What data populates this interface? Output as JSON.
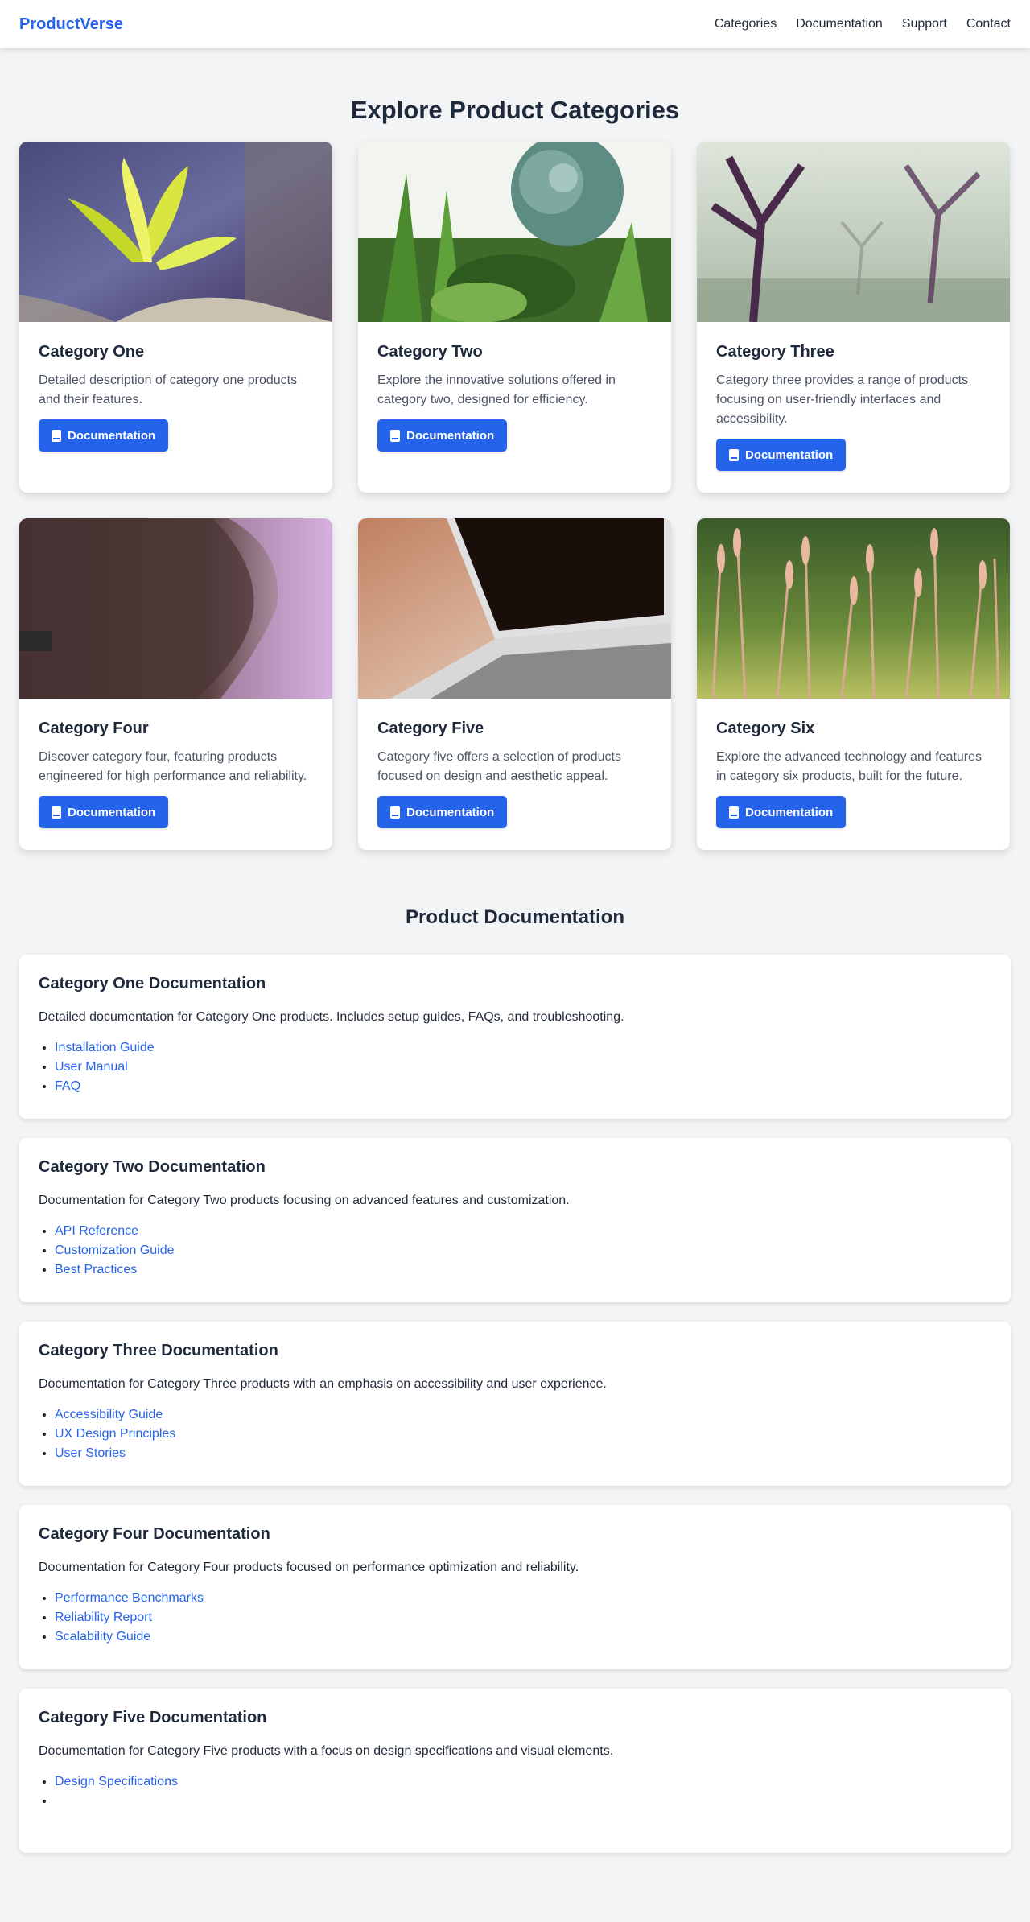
{
  "nav": {
    "brand": "ProductVerse",
    "links": [
      "Categories",
      "Documentation",
      "Support",
      "Contact"
    ]
  },
  "categories_section": {
    "title": "Explore Product Categories",
    "cards": [
      {
        "title": "Category One",
        "description": "Detailed description of category one products and their features.",
        "button": "Documentation",
        "image": "yellow-leaves-photo"
      },
      {
        "title": "Category Two",
        "description": "Explore the innovative solutions offered in category two, designed for efficiency.",
        "button": "Documentation",
        "image": "succulent-plants-photo"
      },
      {
        "title": "Category Three",
        "description": "Category three provides a range of products focusing on user-friendly interfaces and accessibility.",
        "button": "Documentation",
        "image": "misty-trees-photo"
      },
      {
        "title": "Category Four",
        "description": "Discover category four, featuring products engineered for high performance and reliability.",
        "button": "Documentation",
        "image": "woman-profile-photo"
      },
      {
        "title": "Category Five",
        "description": "Category five offers a selection of products focused on design and aesthetic appeal.",
        "button": "Documentation",
        "image": "laptop-photo"
      },
      {
        "title": "Category Six",
        "description": "Explore the advanced technology and features in category six products, built for the future.",
        "button": "Documentation",
        "image": "grass-field-photo"
      }
    ]
  },
  "docs_section": {
    "title": "Product Documentation",
    "items": [
      {
        "title": "Category One Documentation",
        "description": "Detailed documentation for Category One products. Includes setup guides, FAQs, and troubleshooting.",
        "links": [
          "Installation Guide",
          "User Manual",
          "FAQ"
        ]
      },
      {
        "title": "Category Two Documentation",
        "description": "Documentation for Category Two products focusing on advanced features and customization.",
        "links": [
          "API Reference",
          "Customization Guide",
          "Best Practices"
        ]
      },
      {
        "title": "Category Three Documentation",
        "description": "Documentation for Category Three products with an emphasis on accessibility and user experience.",
        "links": [
          "Accessibility Guide",
          "UX Design Principles",
          "User Stories"
        ]
      },
      {
        "title": "Category Four Documentation",
        "description": "Documentation for Category Four products focused on performance optimization and reliability.",
        "links": [
          "Performance Benchmarks",
          "Reliability Report",
          "Scalability Guide"
        ]
      },
      {
        "title": "Category Five Documentation",
        "description": "Documentation for Category Five products with a focus on design specifications and visual elements.",
        "links": [
          "Design Specifications",
          ""
        ]
      }
    ]
  },
  "colors": {
    "accent": "#2563eb",
    "background": "#f3f4f6"
  }
}
